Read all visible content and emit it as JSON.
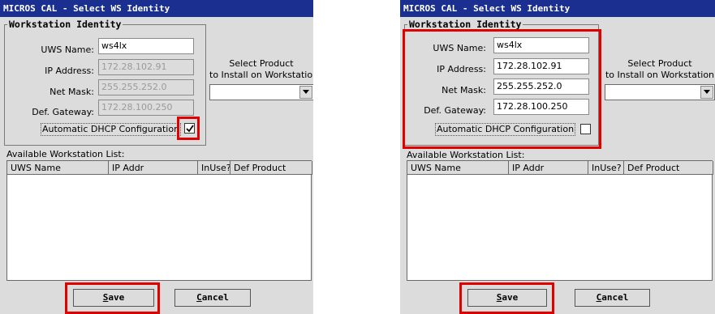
{
  "left": {
    "title": "MICROS CAL - Select WS Identity",
    "group_label": "Workstation Identity",
    "uws_name_label": "UWS Name:",
    "uws_name_value": "ws4lx",
    "ip_label": "IP Address:",
    "ip_value": "172.28.102.91",
    "mask_label": "Net Mask:",
    "mask_value": "255.255.252.0",
    "gateway_label": "Def. Gateway:",
    "gateway_value": "172.28.100.250",
    "dhcp_label": "Automatic DHCP Configuration",
    "dhcp_checked": true,
    "product_label_1": "Select Product",
    "product_label_2": "to Install on Workstation",
    "list_title": "Available Workstation List:",
    "columns": [
      "UWS Name",
      "IP Addr",
      "InUse?",
      "Def Product"
    ],
    "save_rest": "ave",
    "save_accel": "S",
    "cancel_rest": "ancel",
    "cancel_accel": "C"
  },
  "right": {
    "title": "MICROS CAL - Select WS Identity",
    "group_label": "Workstation Identity",
    "uws_name_label": "UWS Name:",
    "uws_name_value": "ws4lx",
    "ip_label": "IP Address:",
    "ip_value": "172.28.102.91",
    "mask_label": "Net Mask:",
    "mask_value": "255.255.252.0",
    "gateway_label": "Def. Gateway:",
    "gateway_value": "172.28.100.250",
    "dhcp_label": "Automatic DHCP Configuration",
    "dhcp_checked": false,
    "product_label_1": "Select Product",
    "product_label_2": "to Install on Workstation",
    "list_title": "Available Workstation List:",
    "columns": [
      "UWS Name",
      "IP Addr",
      "InUse?",
      "Def Product"
    ],
    "save_rest": "ave",
    "save_accel": "S",
    "cancel_rest": "ancel",
    "cancel_accel": "C"
  },
  "colors": {
    "titlebar": "#1a2f8f",
    "highlight": "#e00000",
    "dialog_bg": "#dcdcdc"
  }
}
